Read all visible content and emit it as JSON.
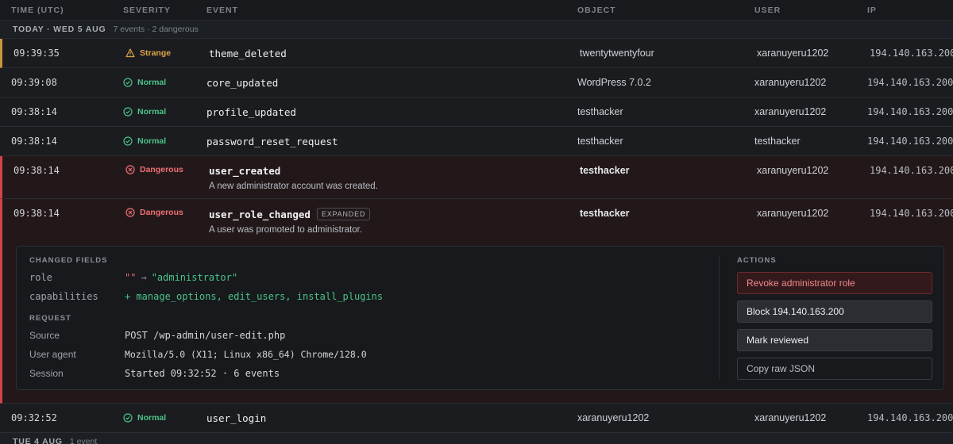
{
  "columns": {
    "time": "TIME (UTC)",
    "severity": "SEVERITY",
    "event": "EVENT",
    "object": "OBJECT",
    "user": "USER",
    "ip": "IP"
  },
  "groups": [
    {
      "label": "TODAY · WED 5 AUG",
      "meta": "7 events · 2 dangerous"
    },
    {
      "label": "TUE 4 AUG",
      "meta": "1 event"
    }
  ],
  "rows": [
    {
      "time": "09:39:35",
      "severity": "Strange",
      "event": "theme_deleted",
      "object": "twentytwentyfour",
      "user": "xaranuyeru1202",
      "ip": "194.140.163.200"
    },
    {
      "time": "09:39:08",
      "severity": "Normal",
      "event": "core_updated",
      "object": "WordPress 7.0.2",
      "user": "xaranuyeru1202",
      "ip": "194.140.163.200"
    },
    {
      "time": "09:38:14",
      "severity": "Normal",
      "event": "profile_updated",
      "object": "testhacker",
      "user": "xaranuyeru1202",
      "ip": "194.140.163.200"
    },
    {
      "time": "09:38:14",
      "severity": "Normal",
      "event": "password_reset_request",
      "object": "testhacker",
      "user": "testhacker",
      "ip": "194.140.163.200"
    },
    {
      "time": "09:38:14",
      "severity": "Dangerous",
      "event": "user_created",
      "description": "A new administrator account was created.",
      "object": "testhacker",
      "user": "xaranuyeru1202",
      "ip": "194.140.163.200"
    },
    {
      "time": "09:38:14",
      "severity": "Dangerous",
      "event": "user_role_changed",
      "badge": "EXPANDED",
      "description": "A user was promoted to administrator.",
      "object": "testhacker",
      "user": "xaranuyeru1202",
      "ip": "194.140.163.200"
    },
    {
      "time": "09:32:52",
      "severity": "Normal",
      "event": "user_login",
      "object": "xaranuyeru1202",
      "user": "xaranuyeru1202",
      "ip": "194.140.163.200"
    }
  ],
  "detail": {
    "changed_fields_title": "CHANGED FIELDS",
    "fields": [
      {
        "key": "role",
        "old": "\"\"",
        "arrow": "→",
        "new": "\"administrator\""
      },
      {
        "key": "capabilities",
        "value": "+ manage_options, edit_users, install_plugins"
      }
    ],
    "request_title": "REQUEST",
    "request": [
      {
        "key": "Source",
        "value": "POST /wp-admin/user-edit.php"
      },
      {
        "key": "User agent",
        "value": "Mozilla/5.0 (X11; Linux x86_64) Chrome/128.0"
      },
      {
        "key": "Session",
        "value": "Started 09:32:52 · 6 events"
      }
    ],
    "actions_title": "ACTIONS",
    "actions": [
      "Revoke administrator role",
      "Block 194.140.163.200",
      "Mark reviewed",
      "Copy raw JSON"
    ]
  },
  "colors": {
    "normal": "#4cc38a",
    "strange": "#e0a64a",
    "dangerous": "#ef6f72",
    "background": "#17191c"
  }
}
